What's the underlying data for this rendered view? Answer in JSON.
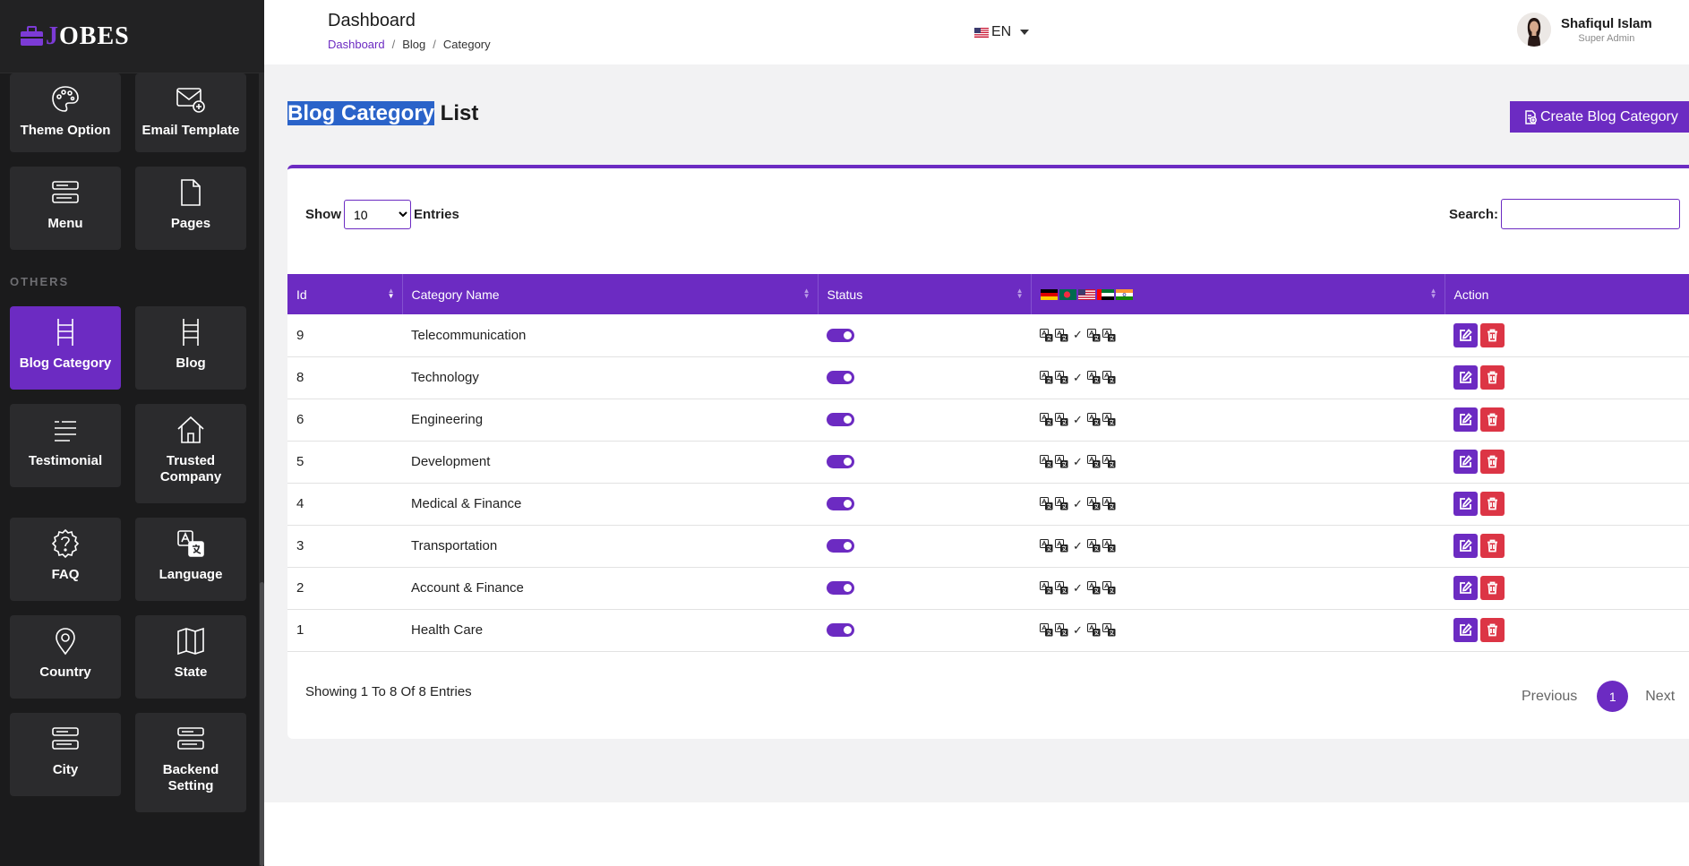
{
  "app": {
    "logo_j": "J",
    "logo_rest": "OBES"
  },
  "sidebar": {
    "tiles_top": [
      {
        "label": "Theme Option",
        "icon": "palette-icon"
      },
      {
        "label": "Email Template",
        "icon": "email-template-icon"
      },
      {
        "label": "Menu",
        "icon": "menu-icon"
      },
      {
        "label": "Pages",
        "icon": "page-icon"
      }
    ],
    "section_others": "OTHERS",
    "tiles_others": [
      {
        "label": "Blog Category",
        "icon": "ladder-icon",
        "active": true
      },
      {
        "label": "Blog",
        "icon": "ladder-icon"
      },
      {
        "label": "Testimonial",
        "icon": "quote-lines-icon"
      },
      {
        "label": "Trusted Company",
        "icon": "home-icon"
      },
      {
        "label": "FAQ",
        "icon": "question-icon"
      },
      {
        "label": "Language",
        "icon": "translate-icon"
      },
      {
        "label": "Country",
        "icon": "map-pin-icon"
      },
      {
        "label": "State",
        "icon": "map-icon"
      },
      {
        "label": "City",
        "icon": "list-card-icon"
      },
      {
        "label": "Backend Setting",
        "icon": "list-card-icon"
      }
    ]
  },
  "header": {
    "title": "Dashboard",
    "breadcrumb": [
      "Dashboard",
      "Blog",
      "Category"
    ],
    "language": "EN",
    "user_name": "Shafiqul Islam",
    "user_role": "Super Admin"
  },
  "page": {
    "title_highlight": "Blog Category",
    "title_rest": " List",
    "create_button": "Create Blog Category"
  },
  "table_controls": {
    "show_label": "Show",
    "entries_label": "Entries",
    "show_value": "10",
    "search_label": "Search:",
    "search_value": ""
  },
  "table": {
    "columns": [
      "Id",
      "Category Name",
      "Status",
      "",
      "Action"
    ],
    "rows": [
      {
        "id": "9",
        "name": "Telecommunication",
        "status": true
      },
      {
        "id": "8",
        "name": "Technology",
        "status": true
      },
      {
        "id": "6",
        "name": "Engineering",
        "status": true
      },
      {
        "id": "5",
        "name": "Development",
        "status": true
      },
      {
        "id": "4",
        "name": "Medical & Finance",
        "status": true
      },
      {
        "id": "3",
        "name": "Transportation",
        "status": true
      },
      {
        "id": "2",
        "name": "Account & Finance",
        "status": true
      },
      {
        "id": "1",
        "name": "Health Care",
        "status": true
      }
    ]
  },
  "footer": {
    "showing": "Showing 1 To 8 Of 8 Entries",
    "previous": "Previous",
    "page": "1",
    "next": "Next"
  },
  "colors": {
    "accent": "#6c2bc2",
    "danger": "#dc3545",
    "sidebar": "#1b1b1c"
  }
}
